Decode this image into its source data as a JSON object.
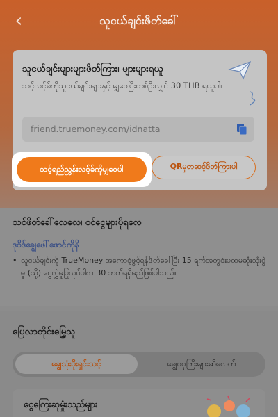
{
  "header": {
    "back_icon": "‹",
    "title": "သူငယ်ချင်းဖိတ်ခေါ်"
  },
  "invite": {
    "heading": "သူငယ်ချင်းများများဖိတ်ကြား၊ များများရယူ",
    "description": "သင့်လင့်ခ်ကိုသူငယ်ချင်းများနှင့် မျှဝေပြီးတစ်ဦးလျှင် 30 THB ရယူပါ။",
    "link": "friend.truemoney.com/idnatta",
    "share_button": "သင့်ရည်ညွှန်းလင့်ခ်ကိုမျှဝေပါ",
    "qr_button": "QRမှတဆင့်ဖိတ်ကြားပါ"
  },
  "info": {
    "heading": "သင်ဖိတ်ခေါ်လေလေ၊ ဝင်ငွေများပိုရလေ",
    "details_link": "ဒုဝိဒ်ချွေဖေါ်ဖောင်ကိုနိ",
    "bullet": "သူငယ်ချင်းကို TrueMoney အကောင့်ဖွင့်ရန်ဖိတ်ခေါ်ပြီး 15 ရက်အတွင်းပထမဆုံးသုံးစွဲမှု (သို့) ငွေလွှဲမှုပြုလုပ်ပါက 30 ဘတ်ရရှိမည်ဖြစ်ပါသည်။"
  },
  "history": {
    "heading": "ပြေလာတိုင်းမြွှေ့သူ",
    "tabs": [
      {
        "label": "ချွေသုံးပိုးရှင်းသင့်"
      },
      {
        "label": "ချွေဝဝှကြီးများဆီလေတ်"
      }
    ]
  },
  "reward": {
    "title": "ငွေကြေးဆုမှုံးသည်များ"
  },
  "colors": {
    "accent": "#f07a1b",
    "link": "#3a4f86",
    "header_bg": "#c9602a"
  }
}
